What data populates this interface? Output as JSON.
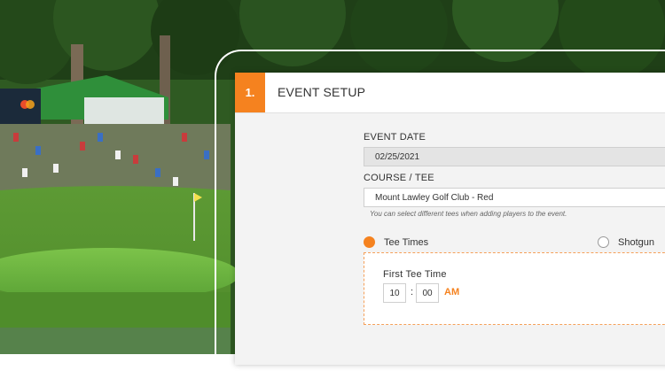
{
  "scene": {
    "flag_color": "#f4e04d"
  },
  "panel": {
    "step_number": "1.",
    "section_title": "EVENT SETUP",
    "event_date": {
      "label": "EVENT DATE",
      "value": "02/25/2021"
    },
    "course_tee": {
      "label": "COURSE / TEE",
      "value": "Mount Lawley Golf Club - Red",
      "hint": "You can select different tees when adding players to the event."
    },
    "start_type": {
      "tee_times_label": "Tee Times",
      "shotgun_label": "Shotgun",
      "selected": "Tee Times"
    },
    "first_tee_time": {
      "label": "First Tee Time",
      "hour": "10",
      "separator": ":",
      "minute": "00",
      "period": "AM"
    }
  },
  "colors": {
    "accent": "#f5821f"
  }
}
